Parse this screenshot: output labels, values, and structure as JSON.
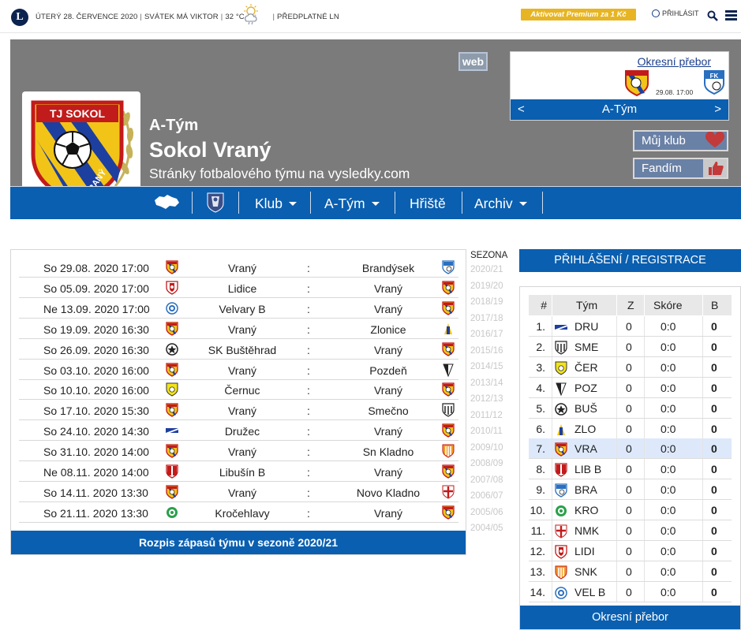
{
  "topbar": {
    "logo_letter": "L",
    "date": "ÚTERÝ 28. ČERVENCE 2020",
    "nameday": "SVÁTEK MÁ VIKTOR",
    "temperature": "32 °C",
    "subscription": "PŘEDPLATNÉ LN",
    "premium": "Aktivovat Premium za 1 Kč",
    "login": "PŘIHLÁSIT"
  },
  "hero": {
    "kicker": "A-Tým",
    "title": "Sokol Vraný",
    "subtitle": "Stránky fotbalového týmu na vysledky.com",
    "crest_text_top": "TJ SOKOL",
    "crest_text_bottom": "VRANÝ",
    "web_badge": "web",
    "next_match": {
      "league": "Okresní přebor",
      "datetime": "29.08. 17:00",
      "team_label": "A-Tým",
      "prev": "<",
      "next": ">"
    },
    "my_club": "Můj klub",
    "fan": "Fandím"
  },
  "nav": {
    "items": [
      "Klub",
      "A-Tým",
      "Hřiště",
      "Archiv"
    ]
  },
  "fixtures": {
    "rows": [
      {
        "date": "So 29.08. 2020 17:00",
        "home": "Vraný",
        "away": "Brandýsek"
      },
      {
        "date": "So 05.09. 2020 17:00",
        "home": "Lidice",
        "away": "Vraný"
      },
      {
        "date": "Ne 13.09. 2020 17:00",
        "home": "Velvary B",
        "away": "Vraný"
      },
      {
        "date": "So 19.09. 2020 16:30",
        "home": "Vraný",
        "away": "Zlonice"
      },
      {
        "date": "So 26.09. 2020 16:30",
        "home": "SK Buštěhrad",
        "away": "Vraný"
      },
      {
        "date": "So 03.10. 2020 16:00",
        "home": "Vraný",
        "away": "Pozdeň"
      },
      {
        "date": "So 10.10. 2020 16:00",
        "home": "Černuc",
        "away": "Vraný"
      },
      {
        "date": "So 17.10. 2020 15:30",
        "home": "Vraný",
        "away": "Smečno"
      },
      {
        "date": "So 24.10. 2020 14:30",
        "home": "Družec",
        "away": "Vraný"
      },
      {
        "date": "So 31.10. 2020 14:00",
        "home": "Vraný",
        "away": "Sn Kladno"
      },
      {
        "date": "Ne 08.11. 2020 14:00",
        "home": "Libušín B",
        "away": "Vraný"
      },
      {
        "date": "So 14.11. 2020 13:30",
        "home": "Vraný",
        "away": "Novo Kladno"
      },
      {
        "date": "So 21.11. 2020 13:30",
        "home": "Kročehlavy",
        "away": "Vraný"
      }
    ],
    "separator": ":",
    "footer": "Rozpis zápasů týmu v sezoně 2020/21"
  },
  "seasons": {
    "heading": "SEZONA",
    "items": [
      "2020/21",
      "2019/20",
      "2018/19",
      "2017/18",
      "2016/17",
      "2015/16",
      "2014/15",
      "2013/14",
      "2012/13",
      "2011/12",
      "2010/11",
      "2009/10",
      "2008/09",
      "2007/08",
      "2006/07",
      "2005/06",
      "2004/05"
    ]
  },
  "registration": "PŘIHLÁŠENÍ / REGISTRACE",
  "standings": {
    "headers": {
      "pos": "#",
      "team": "Tým",
      "z": "Z",
      "score": "Skóre",
      "b": "B"
    },
    "rows": [
      {
        "pos": "1.",
        "team": "DRU",
        "z": "0",
        "score": "0:0",
        "b": "0"
      },
      {
        "pos": "2.",
        "team": "SME",
        "z": "0",
        "score": "0:0",
        "b": "0"
      },
      {
        "pos": "3.",
        "team": "ČER",
        "z": "0",
        "score": "0:0",
        "b": "0"
      },
      {
        "pos": "4.",
        "team": "POZ",
        "z": "0",
        "score": "0:0",
        "b": "0"
      },
      {
        "pos": "5.",
        "team": "BUŠ",
        "z": "0",
        "score": "0:0",
        "b": "0"
      },
      {
        "pos": "6.",
        "team": "ZLO",
        "z": "0",
        "score": "0:0",
        "b": "0"
      },
      {
        "pos": "7.",
        "team": "VRA",
        "z": "0",
        "score": "0:0",
        "b": "0"
      },
      {
        "pos": "8.",
        "team": "LIB B",
        "z": "0",
        "score": "0:0",
        "b": "0"
      },
      {
        "pos": "9.",
        "team": "BRA",
        "z": "0",
        "score": "0:0",
        "b": "0"
      },
      {
        "pos": "10.",
        "team": "KRO",
        "z": "0",
        "score": "0:0",
        "b": "0"
      },
      {
        "pos": "11.",
        "team": "NMK",
        "z": "0",
        "score": "0:0",
        "b": "0"
      },
      {
        "pos": "12.",
        "team": "LIDI",
        "z": "0",
        "score": "0:0",
        "b": "0"
      },
      {
        "pos": "13.",
        "team": "SNK",
        "z": "0",
        "score": "0:0",
        "b": "0"
      },
      {
        "pos": "14.",
        "team": "VEL B",
        "z": "0",
        "score": "0:0",
        "b": "0"
      }
    ],
    "footer": "Okresní přebor"
  },
  "colors": {
    "brand_blue": "#0a5fb0",
    "hero_gray": "#7b7b7b",
    "premium_gold": "#e7b523",
    "highlight_row": "#dde9fb"
  }
}
